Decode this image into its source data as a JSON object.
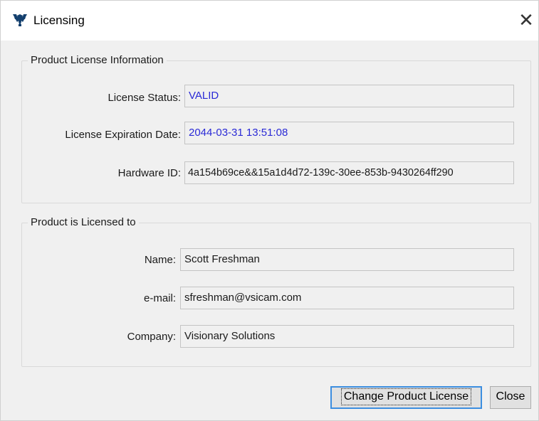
{
  "window": {
    "title": "Licensing",
    "app_icon": "vsi-logo-icon",
    "close_glyph": "✕"
  },
  "product_license_info": {
    "legend": "Product License Information",
    "license_status": {
      "label": "License Status:",
      "value": "VALID"
    },
    "license_expiration": {
      "label": "License Expiration Date:",
      "value": "2044-03-31 13:51:08"
    },
    "hardware_id": {
      "label": "Hardware ID:",
      "value": "4a154b69ce&&15a1d4d72-139c-30ee-853b-9430264ff290"
    }
  },
  "licensed_to": {
    "legend": "Product is Licensed to",
    "name": {
      "label": "Name:",
      "value": "Scott Freshman"
    },
    "email": {
      "label": "e-mail:",
      "value": "sfreshman@vsicam.com"
    },
    "company": {
      "label": "Company:",
      "value": "Visionary Solutions"
    }
  },
  "buttons": {
    "change_license": "Change Product License",
    "close": "Close"
  },
  "colors": {
    "accent_text": "#2a2ad6",
    "default_button_border": "#3c8ee0",
    "logo": "#14406e"
  }
}
